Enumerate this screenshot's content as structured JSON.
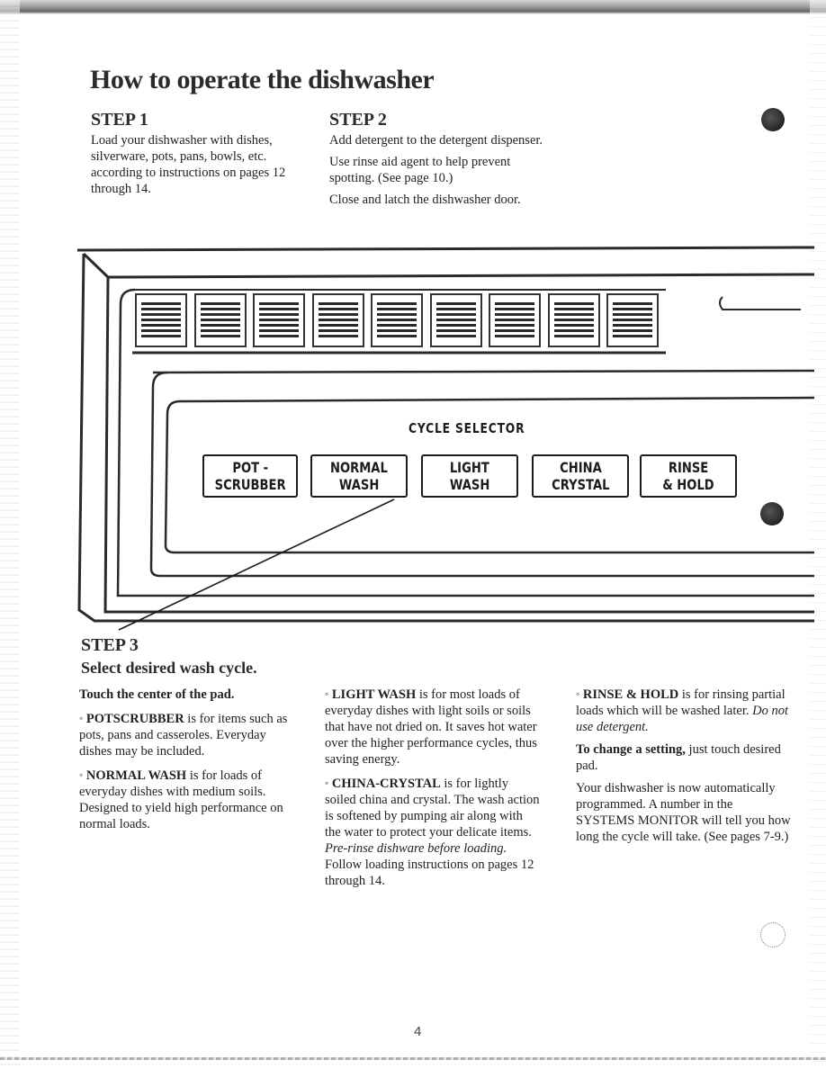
{
  "page": {
    "title": "How to operate the dishwasher",
    "page_number": "4"
  },
  "step1": {
    "heading": "STEP 1",
    "text": "Load your dishwasher with dishes, silverware, pots, pans, bowls, etc. according to instructions on pages 12 through 14."
  },
  "step2": {
    "heading": "STEP 2",
    "paragraphs": [
      "Add detergent to the detergent dispenser.",
      "Use rinse aid agent to help prevent spotting. (See page 10.)",
      "Close and latch the dishwasher door."
    ]
  },
  "control_panel": {
    "display_cells_count": 9,
    "cycle_selector_label": "CYCLE SELECTOR",
    "pads": [
      {
        "line1": "POT -",
        "line2": "SCRUBBER"
      },
      {
        "line1": "NORMAL",
        "line2": "WASH"
      },
      {
        "line1": "LIGHT",
        "line2": "WASH"
      },
      {
        "line1": "CHINA",
        "line2": "CRYSTAL"
      },
      {
        "line1": "RINSE",
        "line2": "& HOLD"
      }
    ]
  },
  "step3": {
    "heading": "STEP 3",
    "subheading": "Select desired wash cycle.",
    "instruction": "Touch the center of the pad.",
    "cycles": [
      {
        "name": "POTSCRUBBER",
        "desc": " is for items such as pots, pans and casseroles. Everyday dishes may be included."
      },
      {
        "name": "NORMAL WASH",
        "desc": " is for loads of everyday dishes with medium soils. Designed to yield high performance on normal loads."
      },
      {
        "name": "LIGHT WASH",
        "desc": " is for most loads of everyday dishes with light soils or soils that have not dried on. It saves hot water over the higher performance cycles, thus saving energy."
      },
      {
        "name": "CHINA-CRYSTAL",
        "desc": " is for lightly soiled china and crystal. The wash action is softened by pumping air along with the water to protect your delicate items. ",
        "italic": "Pre-rinse dishware before loading.",
        "after": " Follow loading instructions on pages 12 through 14."
      },
      {
        "name": "RINSE & HOLD",
        "desc": " is for rinsing partial loads which will be washed later. ",
        "italic": "Do not use detergent."
      }
    ],
    "change_setting_bold": "To change a setting,",
    "change_setting_rest": " just touch desired pad.",
    "programmed_text": "Your dishwasher is now automatically programmed. A number in the SYSTEMS MONITOR will tell you how long the cycle will take. (See pages 7-9.)"
  }
}
